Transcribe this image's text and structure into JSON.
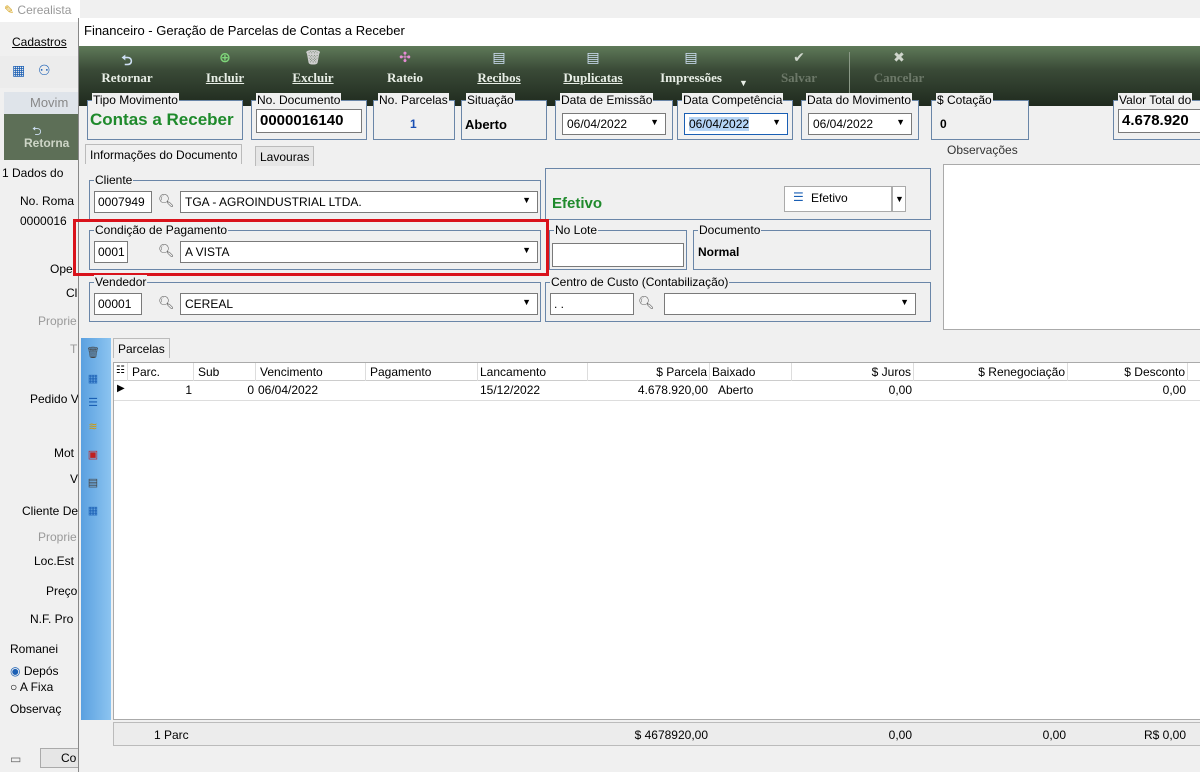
{
  "background": {
    "title": "Cerealista",
    "menu_cadastros": "Cadastros",
    "sub_title": "Movim",
    "sub_retornar": "Retorna",
    "tab_dados": "1 Dados do",
    "no_roma_label": "No. Roma",
    "no_roma_value": "0000016",
    "labels": [
      "Ope",
      "Cl",
      "Proprie",
      "T",
      "Pedido V",
      "Mot",
      "V",
      "Cliente De",
      "Proprie",
      "Loc.Est",
      "Preço",
      "N.F. Pro"
    ],
    "romaneio": "Romanei",
    "radio_deposito": "Depós",
    "radio_fixa": "A Fixa",
    "observacao": "Observaç",
    "bottom_btn": "Co"
  },
  "window": {
    "title": "Financeiro - Geração de Parcelas de Contas a Receber"
  },
  "toolbar": {
    "retornar": "Retornar",
    "incluir": "Incluir",
    "excluir": "Excluir",
    "rateio": "Rateio",
    "recibos": "Recibos",
    "duplicatas": "Duplicatas",
    "impressoes": "Impressões",
    "salvar": "Salvar",
    "cancelar": "Cancelar"
  },
  "fields": {
    "tipo_movimento": {
      "label": "Tipo Movimento",
      "value": "Contas a Receber"
    },
    "no_documento": {
      "label": "No. Documento",
      "value": "0000016140"
    },
    "no_parcelas": {
      "label": "No. Parcelas",
      "value": "1"
    },
    "situacao": {
      "label": "Situação",
      "value": "Aberto"
    },
    "data_emissao": {
      "label": "Data de Emissão",
      "value": "06/04/2022"
    },
    "data_competencia": {
      "label": "Data Competência",
      "value": "06/04/2022"
    },
    "data_movimento": {
      "label": "Data do Movimento",
      "value": "06/04/2022"
    },
    "cotacao": {
      "label": "$ Cotação",
      "value": "0"
    },
    "valor_total": {
      "label": "Valor Total do",
      "value": "4.678.920"
    }
  },
  "tabs": {
    "info": "Informações do Documento",
    "lavouras": "Lavouras"
  },
  "observacoes_label": "Observações",
  "cliente": {
    "label": "Cliente",
    "code": "0007949",
    "name": "TGA - AGROINDUSTRIAL LTDA."
  },
  "status": {
    "efetivo_text": "Efetivo",
    "efetivo_button": "Efetivo"
  },
  "condicao": {
    "label": "Condição de Pagamento",
    "code": "0001",
    "name": "A VISTA"
  },
  "no_lote": {
    "label": "No Lote",
    "value": ""
  },
  "documento": {
    "label": "Documento",
    "value": "Normal"
  },
  "vendedor": {
    "label": "Vendedor",
    "code": "00001",
    "name": "CEREAL"
  },
  "centro_custo": {
    "label": "Centro de Custo (Contabilização)",
    "code": " .  .",
    "name": ""
  },
  "parcelas": {
    "tab": "Parcelas",
    "columns": [
      "Parc.",
      "Sub",
      "Vencimento",
      "Pagamento",
      "Lancamento",
      "$ Parcela",
      "Baixado",
      "$ Juros",
      "$ Renegociação",
      "$ Desconto"
    ],
    "rows": [
      {
        "parc": "1",
        "sub": "0",
        "vencimento": "06/04/2022",
        "pagamento": "",
        "lancamento": "15/12/2022",
        "parcela": "4.678.920,00",
        "baixado": "Aberto",
        "juros": "0,00",
        "reneg": "",
        "desconto": "0,00"
      }
    ],
    "footer": {
      "count": "1 Parc",
      "parcela": "$ 4678920,00",
      "juros": "0,00",
      "reneg": "0,00",
      "desconto": "R$ 0,00"
    }
  },
  "colors": {
    "toolbar": "#3a4a37",
    "highlight": "#d9121b",
    "green_text": "#1f8a2c",
    "group_border": "#6a86a8"
  }
}
